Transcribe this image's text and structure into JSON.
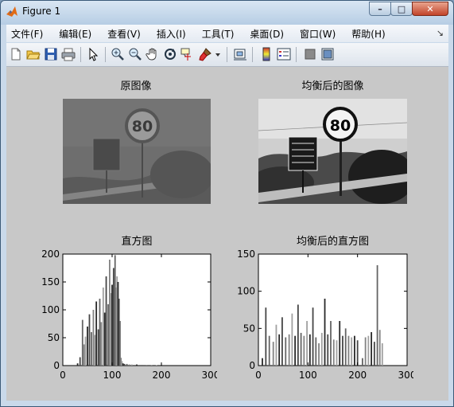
{
  "window": {
    "title": "Figure 1"
  },
  "window_controls": {
    "minimize": "–",
    "maximize": "□",
    "close": "✕"
  },
  "menu": [
    "文件(F)",
    "编辑(E)",
    "查看(V)",
    "插入(I)",
    "工具(T)",
    "桌面(D)",
    "窗口(W)",
    "帮助(H)"
  ],
  "menu_overflow": "↘",
  "toolbar_icons": [
    "new-figure-icon",
    "open-file-icon",
    "save-icon",
    "print-icon",
    "pointer-icon",
    "zoom-in-icon",
    "zoom-out-icon",
    "pan-icon",
    "rotate-3d-icon",
    "data-cursor-icon",
    "brush-icon",
    "brush-dropdown-icon",
    "link-plot-icon",
    "colorbar-icon",
    "legend-icon",
    "hide-plot-tools-icon",
    "show-plot-tools-icon"
  ],
  "figure": {
    "original_title": "原图像",
    "equalized_title": "均衡后的图像",
    "hist_title": "直方图",
    "eq_hist_title": "均衡后的直方图",
    "sign_speed": "80"
  },
  "chart_data": [
    {
      "type": "bar",
      "title": "直方图",
      "xlim": [
        0,
        300
      ],
      "ylim": [
        0,
        200
      ],
      "xticks": [
        0,
        100,
        200,
        300
      ],
      "yticks": [
        0,
        50,
        100,
        150,
        200
      ],
      "x": [
        30,
        35,
        40,
        43,
        46,
        50,
        54,
        58,
        62,
        65,
        68,
        72,
        75,
        78,
        82,
        85,
        88,
        92,
        95,
        98,
        100,
        103,
        106,
        108,
        110,
        112,
        114,
        116,
        118,
        120,
        122,
        125,
        130,
        135,
        140,
        150,
        160,
        170,
        180,
        190,
        200
      ],
      "values": [
        4,
        15,
        82,
        38,
        52,
        70,
        92,
        60,
        100,
        55,
        115,
        65,
        120,
        78,
        140,
        95,
        160,
        110,
        190,
        130,
        145,
        175,
        198,
        140,
        160,
        150,
        120,
        80,
        14,
        8,
        4,
        3,
        3,
        2,
        2,
        2,
        1,
        1,
        1,
        1,
        1
      ]
    },
    {
      "type": "bar",
      "title": "均衡后的直方图",
      "xlim": [
        0,
        300
      ],
      "ylim": [
        0,
        150
      ],
      "xticks": [
        0,
        100,
        200,
        300
      ],
      "yticks": [
        0,
        50,
        100,
        150
      ],
      "x": [
        8,
        15,
        22,
        30,
        36,
        42,
        48,
        55,
        62,
        68,
        74,
        80,
        86,
        92,
        98,
        104,
        110,
        116,
        122,
        128,
        134,
        140,
        146,
        152,
        158,
        164,
        170,
        176,
        182,
        188,
        194,
        200,
        210,
        216,
        222,
        228,
        234,
        240,
        245,
        250
      ],
      "values": [
        10,
        78,
        40,
        32,
        55,
        42,
        65,
        38,
        42,
        70,
        40,
        82,
        44,
        40,
        60,
        42,
        78,
        38,
        30,
        44,
        90,
        42,
        60,
        35,
        34,
        60,
        40,
        50,
        40,
        38,
        40,
        34,
        10,
        38,
        40,
        45,
        32,
        135,
        48,
        30
      ]
    }
  ]
}
